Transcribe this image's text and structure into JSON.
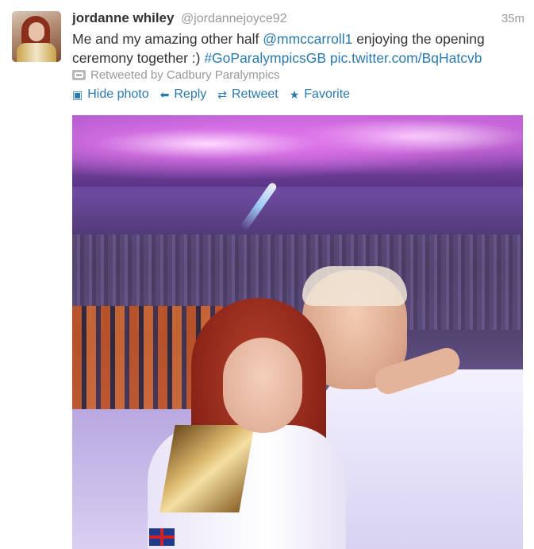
{
  "tweet": {
    "author_name": "jordanne whiley",
    "author_handle": "@jordannejoyce92",
    "timestamp": "35m",
    "text_before": "Me and my amazing other half ",
    "mention": "@mmccarroll1",
    "text_middle": " enjoying the opening ceremony together :) ",
    "hashtag": "#GoParalympicsGB",
    "link": "pic.twitter.com/BqHatcvb",
    "retweeted_by": "Retweeted by Cadbury Paralympics"
  },
  "actions": {
    "hide_photo": "Hide photo",
    "reply": "Reply",
    "retweet": "Retweet",
    "favorite": "Favorite"
  },
  "icons": {
    "hide_photo": "photo-icon",
    "reply": "reply-arrow-icon",
    "retweet": "retweet-icon",
    "favorite": "star-icon"
  },
  "colors": {
    "link": "#2a7ab0",
    "muted": "#999999",
    "text": "#333333"
  }
}
